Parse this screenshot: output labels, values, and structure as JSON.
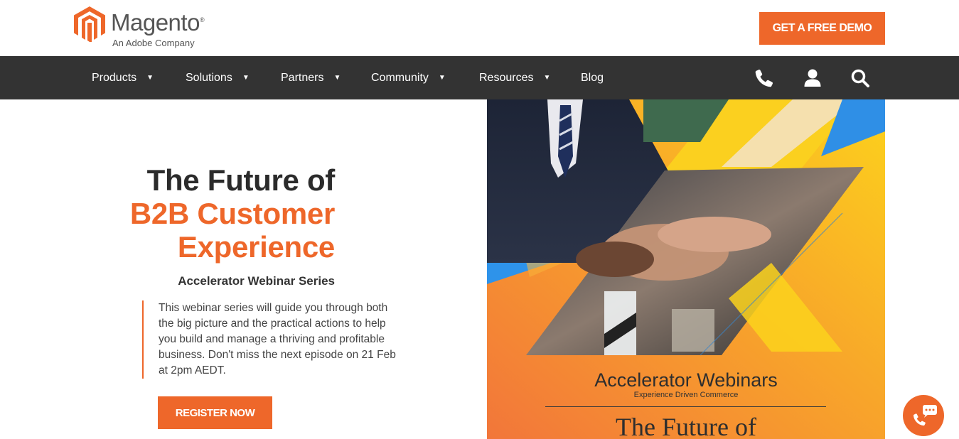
{
  "header": {
    "brand_name": "Magento",
    "brand_registered": "®",
    "brand_tagline": "An Adobe Company",
    "demo_button": "GET A FREE DEMO"
  },
  "nav": {
    "items": [
      {
        "label": "Products",
        "has_dropdown": true
      },
      {
        "label": "Solutions",
        "has_dropdown": true
      },
      {
        "label": "Partners",
        "has_dropdown": true
      },
      {
        "label": "Community",
        "has_dropdown": true
      },
      {
        "label": "Resources",
        "has_dropdown": true
      },
      {
        "label": "Blog",
        "has_dropdown": false
      }
    ],
    "caret": "▼",
    "icons": [
      "phone-icon",
      "user-icon",
      "search-icon"
    ]
  },
  "hero": {
    "title_line1": "The Future of",
    "title_line2": "B2B Customer",
    "title_line3": "Experience",
    "subtitle": "Accelerator Webinar Series",
    "description": "This webinar series will guide you through both the big picture and the practical actions to help you build and manage a thriving and profitable business. Don't miss the next episode on 21 Feb at 2pm AEDT.",
    "register_button": "REGISTER NOW"
  },
  "hero_image": {
    "heading": "Accelerator Webinars",
    "subheading": "Experience Driven Commerce",
    "title": "The Future of"
  },
  "chat": {
    "icon": "chat-phone-icon"
  },
  "colors": {
    "accent": "#ee672a",
    "nav_bg": "#333333",
    "text_dark": "#2b2b2b"
  }
}
